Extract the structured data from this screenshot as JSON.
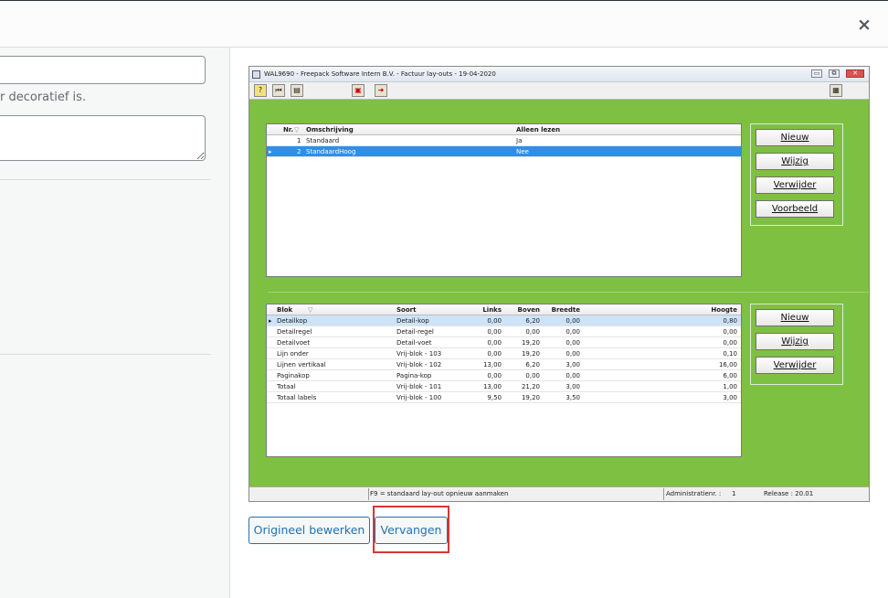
{
  "close_label": "×",
  "left": {
    "alt_value": "",
    "alt_help": "r decoratief is.",
    "caption_value": ""
  },
  "app": {
    "title": "WAL9690  -  Freepack Software Intern B.V.  -  Factuur lay-outs  -  19-04-2020",
    "window_buttons": {
      "minimize": "▭",
      "restore": "⧉",
      "close": "✕"
    },
    "toolbar_icons": [
      "help-icon",
      "first-record-icon",
      "print-icon",
      "export-icon",
      "exit-icon",
      "calculator-icon"
    ],
    "top_grid": {
      "headers": {
        "nr": "Nr.",
        "omschrijving": "Omschrijving",
        "alleen_lezen": "Alleen lezen"
      },
      "rows": [
        {
          "nr": "1",
          "omschrijving": "Standaard",
          "alleen_lezen": "Ja"
        },
        {
          "nr": "2",
          "omschrijving": "StandaardHoog",
          "alleen_lezen": "Nee"
        }
      ]
    },
    "top_buttons": {
      "nieuw": "Nieuw",
      "wijzig": "Wijzig",
      "verwijder": "Verwijder",
      "voorbeeld": "Voorbeeld"
    },
    "bottom_grid": {
      "headers": {
        "blok": "Blok",
        "soort": "Soort",
        "links": "Links",
        "boven": "Boven",
        "breedte": "Breedte",
        "hoogte": "Hoogte"
      },
      "rows": [
        {
          "blok": "Detailkop",
          "soort": "Detail-kop",
          "links": "0,00",
          "boven": "6,20",
          "breedte": "0,00",
          "hoogte": "0,80"
        },
        {
          "blok": "Detailregel",
          "soort": "Detail-regel",
          "links": "0,00",
          "boven": "0,00",
          "breedte": "0,00",
          "hoogte": "0,00"
        },
        {
          "blok": "Detailvoet",
          "soort": "Detail-voet",
          "links": "0,00",
          "boven": "19,20",
          "breedte": "0,00",
          "hoogte": "0,00"
        },
        {
          "blok": "Lijn onder",
          "soort": "Vrij-blok - 103",
          "links": "0,00",
          "boven": "19,20",
          "breedte": "0,00",
          "hoogte": "0,10"
        },
        {
          "blok": "Lijnen vertikaal",
          "soort": "Vrij-blok - 102",
          "links": "13,00",
          "boven": "6,20",
          "breedte": "3,00",
          "hoogte": "16,00"
        },
        {
          "blok": "Paginakop",
          "soort": "Pagina-kop",
          "links": "0,00",
          "boven": "0,00",
          "breedte": "0,00",
          "hoogte": "6,00"
        },
        {
          "blok": "Totaal",
          "soort": "Vrij-blok - 101",
          "links": "13,00",
          "boven": "21,20",
          "breedte": "3,00",
          "hoogte": "1,00"
        },
        {
          "blok": "Totaal labels",
          "soort": "Vrij-blok - 100",
          "links": "9,50",
          "boven": "19,20",
          "breedte": "3,50",
          "hoogte": "3,00"
        }
      ]
    },
    "bottom_buttons": {
      "nieuw": "Nieuw",
      "wijzig": "Wijzig",
      "verwijder": "Verwijder"
    },
    "status": {
      "hint": "F9 = standaard lay-out opnieuw aanmaken",
      "admin": "Administratienr. :",
      "admin_nr": "1",
      "release": "Release : 20.01"
    },
    "colors": {
      "background": "#7ec042",
      "selected_row": "#2f8fe8"
    }
  },
  "actions": {
    "edit_original": "Origineel bewerken",
    "replace": "Vervangen"
  },
  "accent_colors": {
    "primary": "#2271b1",
    "highlight": "#d63638"
  }
}
